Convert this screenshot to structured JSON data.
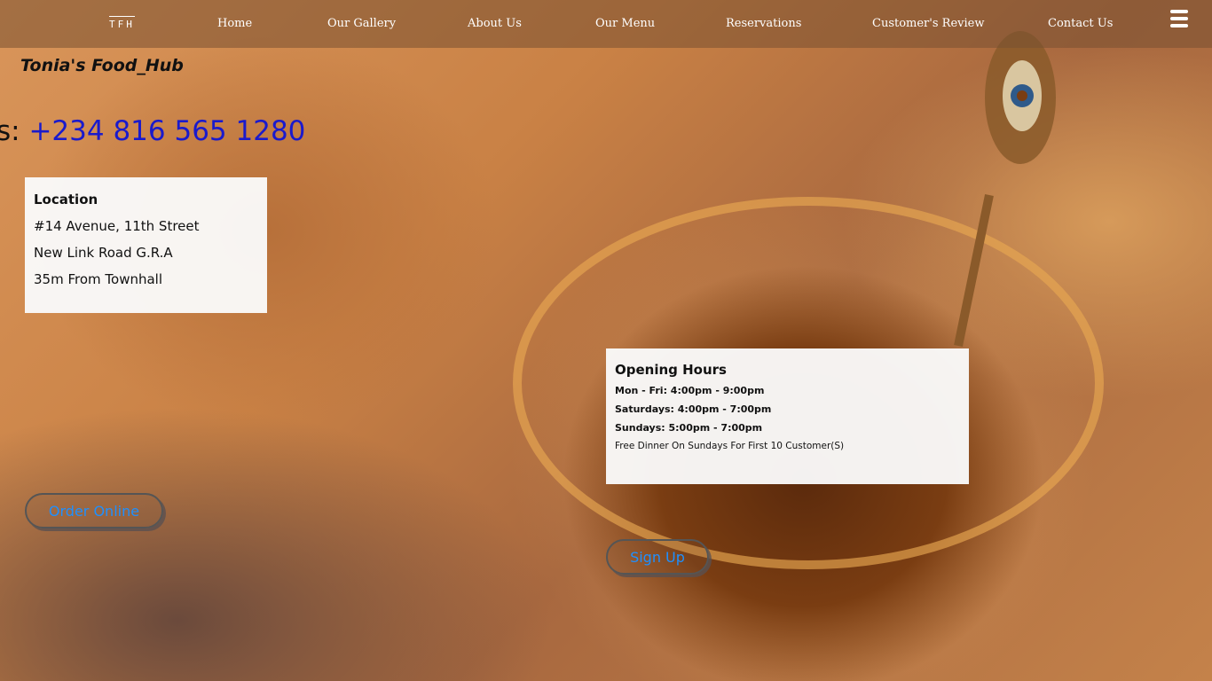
{
  "header": {
    "brand": "TFH",
    "nav": [
      "Home",
      "Our Gallery",
      "About Us",
      "Our Menu",
      "Reservations",
      "Customer's Review",
      "Contact Us"
    ],
    "menu_icon": "hamburger-menu-icon"
  },
  "hero": {
    "site_title": "Tonia's Food_Hub",
    "phone_prefix": "s: ",
    "phone_number": "+234 816 565 1280"
  },
  "location": {
    "heading": "Location",
    "lines": [
      "#14 Avenue, 11th Street",
      "New Link Road G.R.A",
      "35m From Townhall"
    ]
  },
  "hours": {
    "heading": "Opening Hours",
    "lines": [
      "Mon - Fri: 4:00pm - 9:00pm",
      "Saturdays: 4:00pm - 7:00pm",
      "Sundays: 5:00pm - 7:00pm"
    ],
    "note": "Free Dinner On Sundays For First 10 Customer(S)"
  },
  "actions": {
    "order_online": "Order Online",
    "sign_up": "Sign Up"
  },
  "colors": {
    "phone_number": "#1a1acc",
    "button_text": "#1e90ff",
    "topbar": "#785032"
  }
}
